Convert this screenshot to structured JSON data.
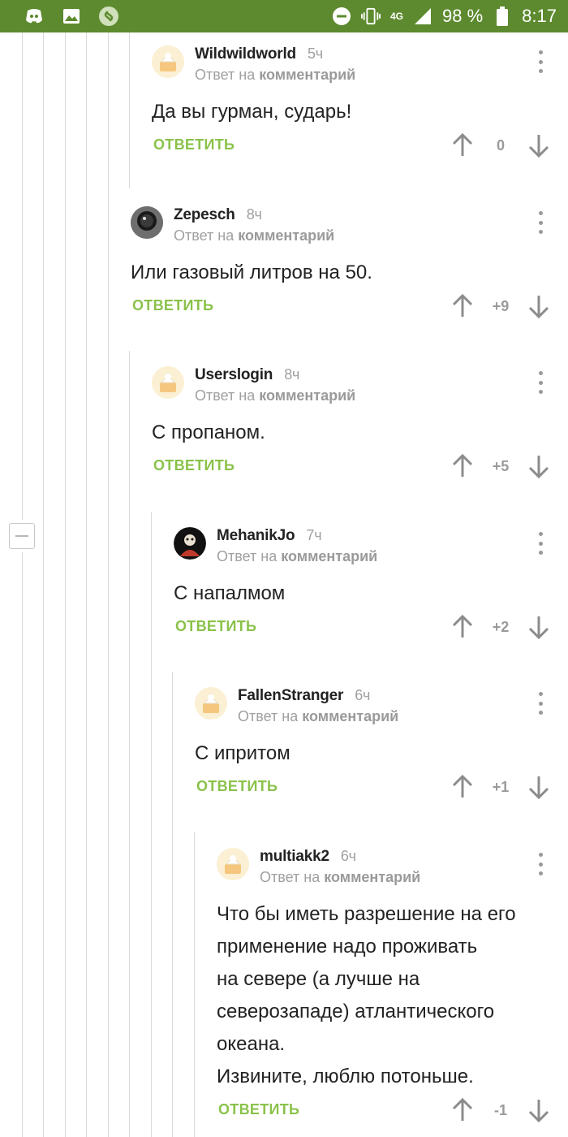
{
  "status_bar": {
    "battery": "98 %",
    "time": "8:17",
    "network": "4G",
    "icons": [
      "discord-icon",
      "image-icon",
      "shazam-icon",
      "do-not-disturb-icon",
      "vibrate-icon",
      "signal-icon",
      "battery-icon"
    ]
  },
  "ui": {
    "reply_label": "ОТВЕТИТЬ",
    "reply_to_prefix": "Ответ на",
    "reply_to_target": "комментарий",
    "accent_color": "#8ac24a",
    "statusbar_color": "#5d8a2e"
  },
  "comments": [
    {
      "author": "Wildwildworld",
      "time": "5ч",
      "text": "Да вы гурман, сударь!",
      "score": "0",
      "avatar": "default-avatar"
    },
    {
      "author": "Zepesch",
      "time": "8ч",
      "text": "Или газовый литров на 50.",
      "score": "+9",
      "avatar": "photo-avatar"
    },
    {
      "author": "Userslogin",
      "time": "8ч",
      "text": "С пропаном.",
      "score": "+5",
      "avatar": "default-avatar"
    },
    {
      "author": "MehanikJo",
      "time": "7ч",
      "text": "С напалмом",
      "score": "+2",
      "avatar": "photo-avatar"
    },
    {
      "author": "FallenStranger",
      "time": "6ч",
      "text": "С ипритом",
      "score": "+1",
      "avatar": "default-avatar"
    },
    {
      "author": "multiakk2",
      "time": "6ч",
      "text": "Что бы иметь разрешение на его\nприменение надо проживать\nна севере (а лучше на\nсеверозападе) атлантического\nокеана.\nИзвините, люблю потоньше.",
      "score": "-1",
      "avatar": "default-avatar"
    }
  ]
}
